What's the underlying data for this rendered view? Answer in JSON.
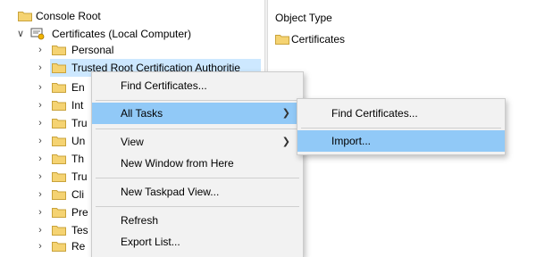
{
  "tree": {
    "root_label": "Console Root",
    "certs_label": "Certificates (Local Computer)",
    "children": [
      {
        "label": "Personal"
      },
      {
        "label": "Trusted Root Certification Authoritie"
      },
      {
        "label": "En"
      },
      {
        "label": "Int"
      },
      {
        "label": "Tru"
      },
      {
        "label": "Un"
      },
      {
        "label": "Th"
      },
      {
        "label": "Tru"
      },
      {
        "label": "Cli"
      },
      {
        "label": "Pre"
      },
      {
        "label": "Tes"
      },
      {
        "label": "Re"
      }
    ]
  },
  "right_pane": {
    "column_header": "Object Type",
    "items": [
      {
        "label": "Certificates"
      }
    ]
  },
  "context_menu": {
    "items": [
      {
        "label": "Find Certificates..."
      },
      {
        "label": "All Tasks",
        "submenu": true
      },
      {
        "label": "View",
        "submenu": true
      },
      {
        "label": "New Window from Here"
      },
      {
        "label": "New Taskpad View..."
      },
      {
        "label": "Refresh"
      },
      {
        "label": "Export List..."
      }
    ]
  },
  "submenu": {
    "items": [
      {
        "label": "Find Certificates..."
      },
      {
        "label": "Import..."
      }
    ]
  },
  "colors": {
    "selection": "#cde8ff",
    "menu_highlight": "#91c9f7",
    "folder_fill": "#f5d372",
    "folder_edge": "#c9a33b"
  }
}
